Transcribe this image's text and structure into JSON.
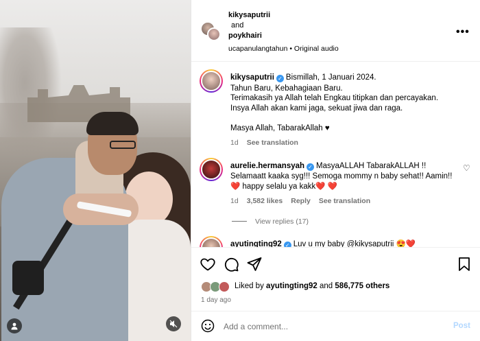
{
  "header": {
    "user1": "kikysaputrii",
    "and_text": "and",
    "user2": "poykhairi",
    "audio": "ucapanulangtahun • Original audio",
    "more_icon": "more-horizontal-icon"
  },
  "caption": {
    "username": "kikysaputrii",
    "lines": [
      "Bismillah, 1 Januari 2024.",
      "Tahun Baru, Kebahagiaan Baru.",
      "Terimakasih ya Allah telah Engkau titipkan dan percayakan.",
      "Insya Allah akan kami jaga, sekuat jiwa dan raga.",
      "Masya Allah, TabarakAllah ♥"
    ],
    "age": "1d",
    "see_translation": "See translation"
  },
  "comment1": {
    "username": "aurelie.hermansyah",
    "text1": "MasyaALLAH TabarakALLAH !!",
    "text2": "Selamaatt kaaka syg!!! Semoga mommy n baby sehat!! Aamin!!",
    "text3_hearts_left": "❤️",
    "text3": "happy selalu ya kakk",
    "text3_hearts_right": "❤️ ❤️",
    "age": "1d",
    "likes": "3,582 likes",
    "reply": "Reply",
    "see_translation": "See translation",
    "view_replies": "View replies (17)"
  },
  "comment2": {
    "username": "ayutingting92",
    "text": "Luv u my baby @kikysaputrii 😍❤️"
  },
  "actions": {
    "liked_by_prefix": "Liked by",
    "liked_by_user": "ayutingting92",
    "and_others": "and",
    "others_count": "586,775 others",
    "date": "1 day ago"
  },
  "add_comment": {
    "placeholder": "Add a comment...",
    "post_label": "Post"
  },
  "colors": {
    "verified": "#3897f0",
    "heart": "#ed1d3a",
    "post_disabled": "#b3d8ff",
    "muted_text": "#737373"
  }
}
